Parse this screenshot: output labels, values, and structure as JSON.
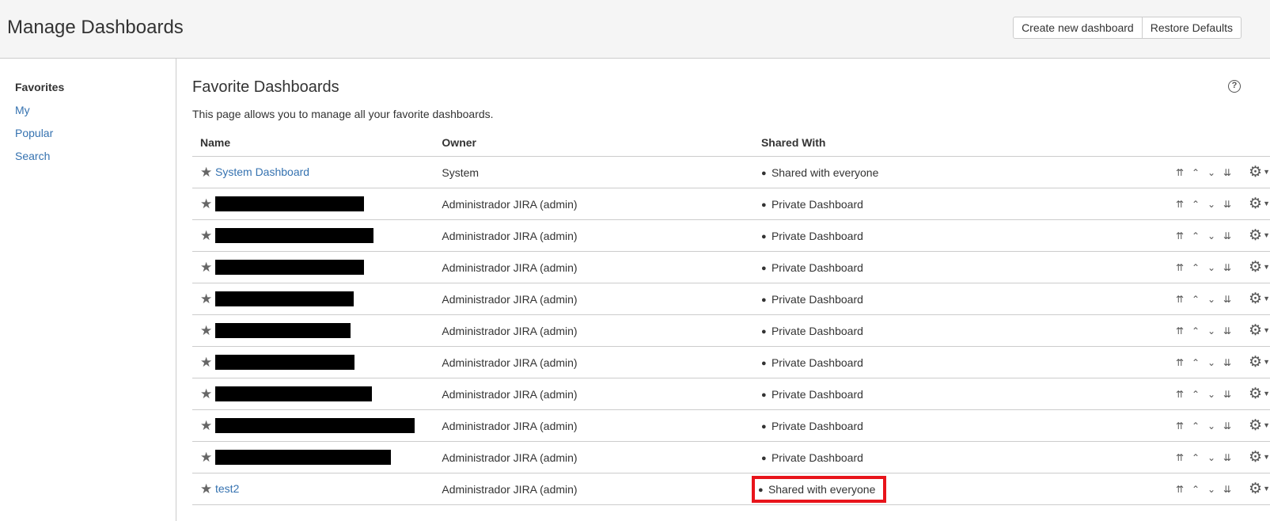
{
  "header": {
    "title": "Manage Dashboards",
    "create_button": "Create new dashboard",
    "restore_button": "Restore Defaults"
  },
  "sidebar": {
    "items": [
      {
        "label": "Favorites",
        "active": true
      },
      {
        "label": "My",
        "active": false
      },
      {
        "label": "Popular",
        "active": false
      },
      {
        "label": "Search",
        "active": false
      }
    ]
  },
  "main": {
    "section_title": "Favorite Dashboards",
    "help_icon": "?",
    "description": "This page allows you to manage all your favorite dashboards.",
    "columns": [
      "Name",
      "Owner",
      "Shared With"
    ],
    "rows": [
      {
        "name": "System Dashboard",
        "owner": "System",
        "shared": "Shared with everyone"
      },
      {
        "name": "",
        "owner": "Administrador JIRA (admin)",
        "shared": "Private Dashboard"
      },
      {
        "name": "",
        "owner": "Administrador JIRA (admin)",
        "shared": "Private Dashboard"
      },
      {
        "name": "",
        "owner": "Administrador JIRA (admin)",
        "shared": "Private Dashboard"
      },
      {
        "name": "",
        "owner": "Administrador JIRA (admin)",
        "shared": "Private Dashboard"
      },
      {
        "name": "",
        "owner": "Administrador JIRA (admin)",
        "shared": "Private Dashboard"
      },
      {
        "name": "",
        "owner": "Administrador JIRA (admin)",
        "shared": "Private Dashboard"
      },
      {
        "name": "",
        "owner": "Administrador JIRA (admin)",
        "shared": "Private Dashboard"
      },
      {
        "name": "",
        "owner": "Administrador JIRA (admin)",
        "shared": "Private Dashboard"
      },
      {
        "name": "",
        "owner": "Administrador JIRA (admin)",
        "shared": "Private Dashboard"
      },
      {
        "name": "test2",
        "owner": "Administrador JIRA (admin)",
        "shared": "Shared with everyone"
      }
    ]
  },
  "icons": {
    "star": "star-icon",
    "move_top": "double-chevron-up-icon",
    "move_up": "chevron-up-icon",
    "move_down": "chevron-down-icon",
    "move_bottom": "double-chevron-down-icon",
    "gear": "gear-icon"
  },
  "colors": {
    "link": "#3572b0",
    "highlight": "#e8141b",
    "header_bg": "#f5f5f5"
  }
}
